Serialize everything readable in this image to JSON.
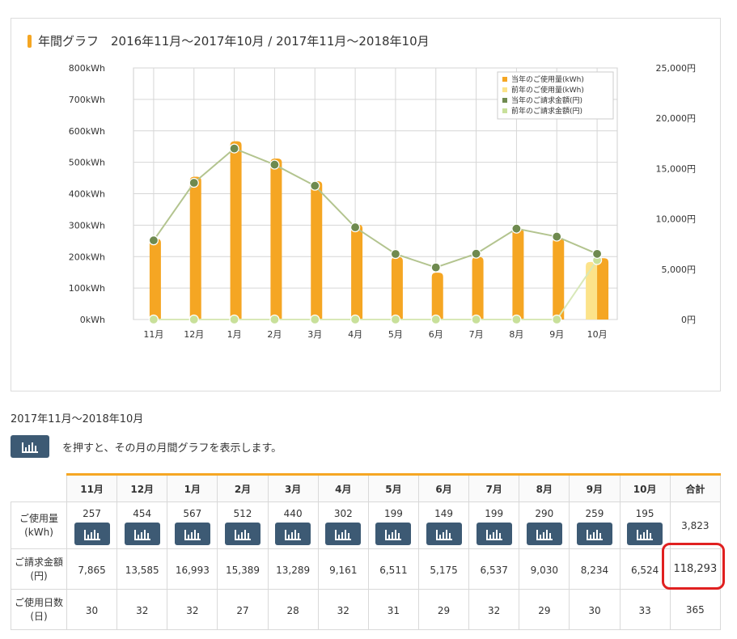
{
  "chart_panel": {
    "title": "年間グラフ　2016年11月～2017年10月 / 2017年11月～2018年10月"
  },
  "chart_data": {
    "type": "bar",
    "categories": [
      "11月",
      "12月",
      "1月",
      "2月",
      "3月",
      "4月",
      "5月",
      "6月",
      "7月",
      "8月",
      "9月",
      "10月"
    ],
    "y_left_ticks": [
      "800kWh",
      "700kWh",
      "600kWh",
      "500kWh",
      "400kWh",
      "300kWh",
      "200kWh",
      "100kWh",
      "0kWh"
    ],
    "y_right_ticks": [
      "25,000円",
      "20,000円",
      "15,000円",
      "10,000円",
      "5,000円",
      "0円"
    ],
    "ylim_left": [
      0,
      800
    ],
    "ylim_right": [
      0,
      25000
    ],
    "legend_position": "top-right",
    "grid": true,
    "series": [
      {
        "name": "当年のご使用量(kWh)",
        "kind": "bar",
        "axis": "left",
        "color": "#f5a623",
        "values": [
          257,
          454,
          567,
          512,
          440,
          302,
          199,
          149,
          199,
          290,
          259,
          195
        ]
      },
      {
        "name": "前年のご使用量(kWh)",
        "kind": "bar",
        "axis": "left",
        "color": "#fce38a",
        "values": [
          0,
          0,
          0,
          0,
          0,
          0,
          0,
          0,
          0,
          0,
          0,
          183
        ]
      },
      {
        "name": "当年のご請求金額(円)",
        "kind": "line",
        "axis": "right",
        "color": "#6f8a4f",
        "values": [
          7865,
          13585,
          16993,
          15389,
          13289,
          9161,
          6511,
          5175,
          6537,
          9030,
          8234,
          6524
        ]
      },
      {
        "name": "前年のご請求金額(円)",
        "kind": "line",
        "axis": "right",
        "color": "#c8e09a",
        "values": [
          0,
          0,
          0,
          0,
          0,
          0,
          0,
          0,
          0,
          0,
          0,
          5900
        ]
      }
    ]
  },
  "period_label": "2017年11月～2018年10月",
  "hint_text": "を押すと、その月の月間グラフを表示します。",
  "table": {
    "headers": [
      "11月",
      "12月",
      "1月",
      "2月",
      "3月",
      "4月",
      "5月",
      "6月",
      "7月",
      "8月",
      "9月",
      "10月",
      "合計"
    ],
    "rows": {
      "usage": {
        "label1": "ご使用量",
        "label2": "(kWh)",
        "values": [
          "257",
          "454",
          "567",
          "512",
          "440",
          "302",
          "199",
          "149",
          "199",
          "290",
          "259",
          "195"
        ],
        "total": "3,823"
      },
      "billing": {
        "label1": "ご請求金額",
        "label2": "(円)",
        "values": [
          "7,865",
          "13,585",
          "16,993",
          "15,389",
          "13,289",
          "9,161",
          "6,511",
          "5,175",
          "6,537",
          "9,030",
          "8,234",
          "6,524"
        ],
        "total": "118,293"
      },
      "days": {
        "label1": "ご使用日数",
        "label2": "(日)",
        "values": [
          "30",
          "32",
          "32",
          "27",
          "28",
          "32",
          "31",
          "29",
          "32",
          "29",
          "30",
          "33"
        ],
        "total": "365"
      }
    }
  },
  "icons": {
    "graph_button": "bar-chart-icon"
  },
  "colors": {
    "accent": "#f5a623",
    "button": "#3d5a74",
    "highlight": "#e02020"
  }
}
